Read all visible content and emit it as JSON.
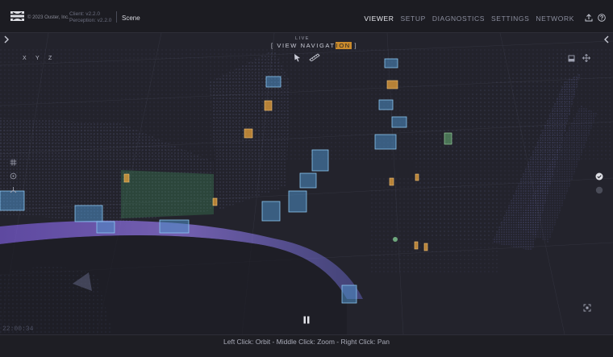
{
  "header": {
    "copyright": "© 2023 Ouster, Inc.",
    "client_version": "Client: v2.2.0",
    "perception_version": "Perception: v2.2.0",
    "scene_label": "Scene",
    "nav": [
      {
        "label": "VIEWER",
        "active": true
      },
      {
        "label": "SETUP",
        "active": false
      },
      {
        "label": "DIAGNOSTICS",
        "active": false
      },
      {
        "label": "SETTINGS",
        "active": false
      },
      {
        "label": "NETWORK",
        "active": false
      }
    ],
    "icons": [
      "upload-icon",
      "help-icon"
    ]
  },
  "viewport": {
    "live_label": "LIVE",
    "view_nav_prefix": "[ VIEW NAVIGAT",
    "view_nav_highlight": "ION",
    "view_nav_suffix": " ]",
    "axes": [
      "X",
      "Y",
      "Z"
    ],
    "timestamp": "22:00:34",
    "left_tools": [
      "grid-icon",
      "target-icon",
      "axes-icon"
    ],
    "right_tools": [
      "check-icon",
      "circle-icon"
    ],
    "toolbar_icons": [
      "cursor-icon",
      "ruler-icon"
    ],
    "view_icons": [
      "camera-view-icon",
      "move-icon",
      "fit-view-icon"
    ],
    "colors": {
      "point_cloud": "#6e6fd8",
      "tracked_object": "#5aa4d8",
      "person": "#e8a23a",
      "highlight": "#c98a2c"
    }
  },
  "footer": {
    "hint": "Left Click: Orbit - Middle Click: Zoom - Right Click: Pan"
  }
}
